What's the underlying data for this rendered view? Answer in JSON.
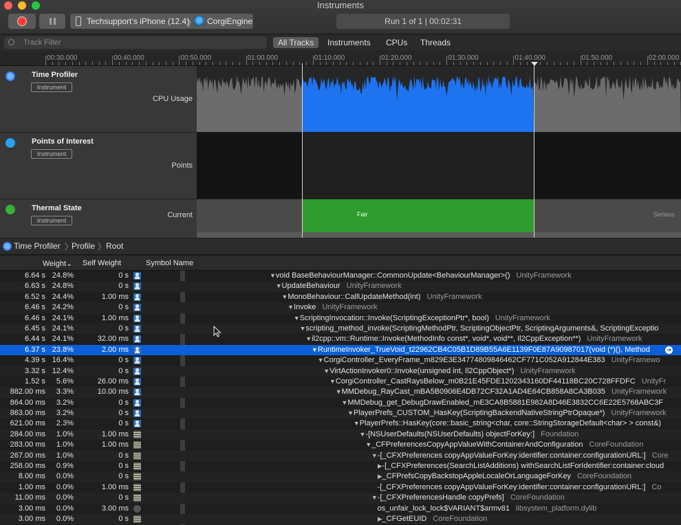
{
  "window": {
    "title": "Instruments"
  },
  "toolbar": {
    "device": "Techsupport’s iPhone (12.4)",
    "separator": "〉",
    "app": "CorgiEngine",
    "run_status": "Run 1 of 1  |  00:02:31"
  },
  "filter": {
    "placeholder": "Track Filter"
  },
  "tabs": [
    "All Tracks",
    "Instruments",
    "CPUs",
    "Threads"
  ],
  "timeline": {
    "ticks": [
      "00:30.000",
      "00:40.000",
      "00:50.000",
      "01:00.000",
      "01:10.000",
      "01:20.000",
      "01:30.000",
      "01:40.000",
      "01:50.000",
      "02:00.000"
    ]
  },
  "tracks": [
    {
      "name": "Time Profiler",
      "badge": "Instrument",
      "subtitle": "CPU Usage",
      "icon": "time-profiler-icon",
      "color": "#1e6fe8"
    },
    {
      "name": "Points of Interest",
      "badge": "Instrument",
      "subtitle": "Points",
      "icon": "points-of-interest-icon",
      "color": "#2aa0ef"
    },
    {
      "name": "Thermal State",
      "badge": "Instrument",
      "subtitle": "Current",
      "icon": "thermal-state-icon",
      "color": "#36b03a",
      "segments": [
        "Fair",
        "Serious"
      ]
    }
  ],
  "breadcrumb": [
    "Time Profiler",
    "Profile",
    "Root"
  ],
  "table": {
    "headers": {
      "weight": "Weight⌄",
      "self": "Self Weight",
      "symbol": "Symbol Name"
    },
    "rows": [
      {
        "w": "6.64 s",
        "p": "24.8%",
        "s": "0 s",
        "icon": "user",
        "indent": 0,
        "disc": "▼",
        "sym": "void BaseBehaviourManager::CommonUpdate<BehaviourManager>()",
        "lib": "UnityFramework"
      },
      {
        "w": "6.63 s",
        "p": "24.8%",
        "s": "0 s",
        "icon": "user",
        "indent": 1,
        "disc": "▼",
        "sym": "UpdateBehaviour",
        "lib": "UnityFramework"
      },
      {
        "w": "6.52 s",
        "p": "24.4%",
        "s": "1.00 ms",
        "icon": "user",
        "indent": 2,
        "disc": "▼",
        "sym": "MonoBehaviour::CallUpdateMethod(int)",
        "lib": "UnityFramework"
      },
      {
        "w": "6.46 s",
        "p": "24.2%",
        "s": "0 s",
        "icon": "user",
        "indent": 3,
        "disc": "▼",
        "sym": "Invoke",
        "lib": "UnityFramework"
      },
      {
        "w": "6.46 s",
        "p": "24.1%",
        "s": "1.00 ms",
        "icon": "user",
        "indent": 4,
        "disc": "▼",
        "sym": "ScriptingInvocation::Invoke(ScriptingExceptionPtr*, bool)",
        "lib": "UnityFramework"
      },
      {
        "w": "6.45 s",
        "p": "24.1%",
        "s": "0 s",
        "icon": "user",
        "indent": 5,
        "disc": "▼",
        "sym": "scripting_method_invoke(ScriptingMethodPtr, ScriptingObjectPtr, ScriptingArguments&, ScriptingExceptio",
        "lib": ""
      },
      {
        "w": "6.44 s",
        "p": "24.1%",
        "s": "32.00 ms",
        "icon": "user",
        "indent": 6,
        "disc": "▼",
        "sym": "il2cpp::vm::Runtime::Invoke(MethodInfo const*, void*, void**, Il2CppException**)",
        "lib": "UnityFramework"
      },
      {
        "w": "6.37 s",
        "p": "23.8%",
        "s": "2.00 ms",
        "icon": "user",
        "indent": 7,
        "disc": "▼",
        "sym": "RuntimeInvoker_TrueVoid_t22962CB4C05B1D89B55A6E1139F0E87A90987017(void (*)(), Method",
        "lib": "",
        "selected": true
      },
      {
        "w": "4.39 s",
        "p": "16.4%",
        "s": "0 s",
        "icon": "user",
        "indent": 8,
        "disc": "▼",
        "sym": "CorgiController_EveryFrame_m829E3E34774809846462CF771C052A912844E383",
        "lib": "UnityFramewo"
      },
      {
        "w": "3.32 s",
        "p": "12.4%",
        "s": "0 s",
        "icon": "user",
        "indent": 9,
        "disc": "▼",
        "sym": "VirtActionInvoker0::Invoke(unsigned int, Il2CppObject*)",
        "lib": "UnityFramework"
      },
      {
        "w": "1.52 s",
        "p": "5.6%",
        "s": "26.00 ms",
        "icon": "user",
        "indent": 10,
        "disc": "▼",
        "sym": "CorgiController_CastRaysBelow_m0B21E45FDE1202343160DF44118BC20C728FFDFC",
        "lib": "UnityFr"
      },
      {
        "w": "882.00 ms",
        "p": "3.3%",
        "s": "10.00 ms",
        "icon": "user",
        "indent": 11,
        "disc": "▼",
        "sym": "MMDebug_RayCast_mBA5B0906E4DB72CF32A1AD4E64CB858A8CA3B035",
        "lib": "UnityFramework"
      },
      {
        "w": "864.00 ms",
        "p": "3.2%",
        "s": "0 s",
        "icon": "user",
        "indent": 12,
        "disc": "▼",
        "sym": "MMDebug_get_DebugDrawEnabled_mE3CA8B5881E982A8D46E3832CC6E22E5768ABC3F",
        "lib": ""
      },
      {
        "w": "863.00 ms",
        "p": "3.2%",
        "s": "0 s",
        "icon": "user",
        "indent": 13,
        "disc": "▼",
        "sym": "PlayerPrefs_CUSTOM_HasKey(ScriptingBackendNativeStringPtrOpaque*)",
        "lib": "UnityFramework"
      },
      {
        "w": "621.00 ms",
        "p": "2.3%",
        "s": "0 s",
        "icon": "user",
        "indent": 14,
        "disc": "▼",
        "sym": "PlayerPrefs::HasKey(core::basic_string<char, core::StringStorageDefault<char> > const&)",
        "lib": ""
      },
      {
        "w": "284.00 ms",
        "p": "1.0%",
        "s": "1.00 ms",
        "icon": "framework",
        "indent": 15,
        "disc": "▼",
        "sym": "-[NSUserDefaults(NSUserDefaults) objectForKey:]",
        "lib": "Foundation"
      },
      {
        "w": "283.00 ms",
        "p": "1.0%",
        "s": "1.00 ms",
        "icon": "framework",
        "indent": 16,
        "disc": "▼",
        "sym": "_CFPreferencesCopyAppValueWithContainerAndConfiguration",
        "lib": "CoreFoundation"
      },
      {
        "w": "267.00 ms",
        "p": "1.0%",
        "s": "0 s",
        "icon": "framework",
        "indent": 17,
        "disc": "▼",
        "sym": "-[_CFXPreferences copyAppValueForKey:identifier:container:configurationURL:]",
        "lib": "Core"
      },
      {
        "w": "258.00 ms",
        "p": "0.9%",
        "s": "0 s",
        "icon": "framework",
        "indent": 18,
        "disc": "▶",
        "sym": "-[_CFXPreferences(SearchListAdditions) withSearchListForIdentifier:container:cloud",
        "lib": ""
      },
      {
        "w": "8.00 ms",
        "p": "0.0%",
        "s": "0 s",
        "icon": "framework",
        "indent": 18,
        "disc": "▶",
        "sym": "_CFPrefsCopyBackstopAppleLocaleOrLanguageForKey",
        "lib": "CoreFoundation"
      },
      {
        "w": "1.00 ms",
        "p": "0.0%",
        "s": "1.00 ms",
        "icon": "framework",
        "indent": 18,
        "disc": "",
        "sym": "-[_CFXPreferences copyAppValueForKey:identifier:container:configurationURL:]",
        "lib": "Co"
      },
      {
        "w": "11.00 ms",
        "p": "0.0%",
        "s": "0 s",
        "icon": "framework",
        "indent": 17,
        "disc": "▼",
        "sym": "-[_CFXPreferencesHandle copyPrefs]",
        "lib": "CoreFoundation"
      },
      {
        "w": "3.00 ms",
        "p": "0.0%",
        "s": "3.00 ms",
        "icon": "lib",
        "indent": 18,
        "disc": "",
        "sym": "os_unfair_lock_lock$VARIANT$armv81",
        "lib": "libsystem_platform.dylib"
      },
      {
        "w": "3.00 ms",
        "p": "0.0%",
        "s": "0 s",
        "icon": "framework",
        "indent": 18,
        "disc": "▶",
        "sym": "_CFGetEUID",
        "lib": "CoreFoundation"
      }
    ]
  }
}
